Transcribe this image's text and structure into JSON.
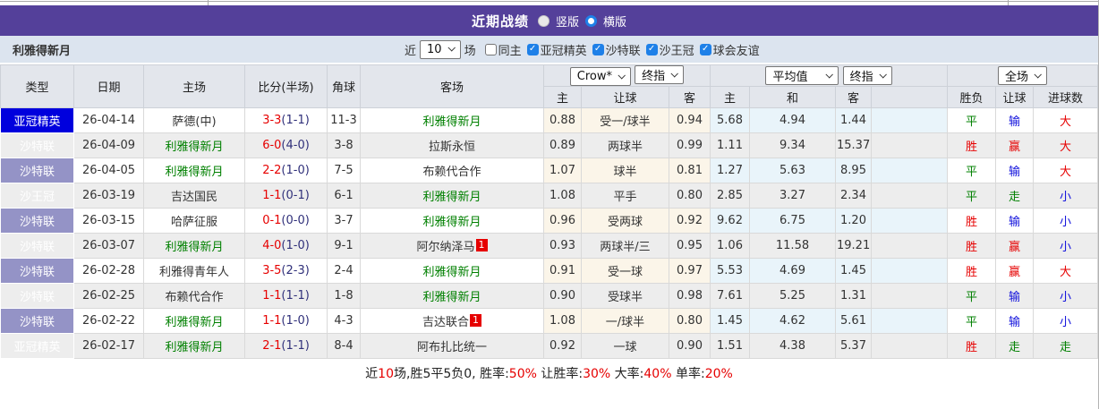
{
  "colors": {
    "accent_purple": "#54409a",
    "filter_bar_bg": "#dce4ef",
    "header_bg": "#e3e6ec",
    "type_acl_blue": "#0000dd",
    "type_saudi_league_purple": "#9493c6",
    "type_kings_cup_navy": "#3f3d8a",
    "team_green": "#008000",
    "win_red": "#e60000",
    "lose_blue": "#1010dc",
    "asian_odds_bg": "#fbf5e9",
    "euro_odds_bg": "#e9f4fa",
    "checkbox_blue": "#1e80e8"
  },
  "title_bar": {
    "title": "近期战绩",
    "vertical_label": "竖版",
    "horizontal_label": "横版",
    "selected_layout": "横版"
  },
  "filter_bar": {
    "team_name": "利雅得新月",
    "near_label": "近",
    "match_count": "10",
    "games_label": "场",
    "checkboxes": [
      {
        "label": "同主",
        "checked": false
      },
      {
        "label": "亚冠精英",
        "checked": true
      },
      {
        "label": "沙特联",
        "checked": true
      },
      {
        "label": "沙王冠",
        "checked": true
      },
      {
        "label": "球会友谊",
        "checked": true
      }
    ]
  },
  "table": {
    "selects": {
      "bookmaker": "Crow*",
      "asian_stage": "终指",
      "euro_source": "平均值",
      "euro_stage": "终指",
      "scope": "全场"
    },
    "headers": {
      "type": "类型",
      "date": "日期",
      "home": "主场",
      "score": "比分(半场)",
      "corner": "角球",
      "away": "客场",
      "asian_home": "主",
      "asian_line": "让球",
      "asian_away": "客",
      "euro_home": "主",
      "euro_draw": "和",
      "euro_away": "客",
      "res_outcome": "胜负",
      "res_handicap": "让球",
      "res_goals": "进球数"
    },
    "rows": [
      {
        "type": "亚冠精英",
        "type_style": "acl",
        "date": "26-04-14",
        "home": "萨德(中)",
        "home_is_team": false,
        "score": "3-3",
        "half": "(1-1)",
        "corner": "11-3",
        "away": "利雅得新月",
        "away_is_team": true,
        "away_badge": "",
        "asian": [
          "0.88",
          "受一/球半",
          "0.94"
        ],
        "euro": [
          "5.68",
          "4.94",
          "1.44"
        ],
        "results": [
          {
            "text": "平",
            "color": "green"
          },
          {
            "text": "输",
            "color": "blue"
          },
          {
            "text": "大",
            "color": "red"
          }
        ]
      },
      {
        "type": "沙特联",
        "type_style": "spl",
        "date": "26-04-09",
        "home": "利雅得新月",
        "home_is_team": true,
        "score": "6-0",
        "half": "(4-0)",
        "corner": "3-8",
        "away": "拉斯永恒",
        "away_is_team": false,
        "away_badge": "",
        "asian": [
          "0.89",
          "两球半",
          "0.99"
        ],
        "euro": [
          "1.11",
          "9.34",
          "15.37"
        ],
        "results": [
          {
            "text": "胜",
            "color": "red"
          },
          {
            "text": "赢",
            "color": "red"
          },
          {
            "text": "大",
            "color": "red"
          }
        ]
      },
      {
        "type": "沙特联",
        "type_style": "spl",
        "date": "26-04-05",
        "home": "利雅得新月",
        "home_is_team": true,
        "score": "2-2",
        "half": "(1-0)",
        "corner": "7-5",
        "away": "布赖代合作",
        "away_is_team": false,
        "away_badge": "",
        "asian": [
          "1.07",
          "球半",
          "0.81"
        ],
        "euro": [
          "1.27",
          "5.63",
          "8.95"
        ],
        "results": [
          {
            "text": "平",
            "color": "green"
          },
          {
            "text": "输",
            "color": "blue"
          },
          {
            "text": "大",
            "color": "red"
          }
        ]
      },
      {
        "type": "沙王冠",
        "type_style": "kingscup",
        "date": "26-03-19",
        "home": "吉达国民",
        "home_is_team": false,
        "score": "1-1",
        "half": "(0-1)",
        "corner": "6-1",
        "away": "利雅得新月",
        "away_is_team": true,
        "away_badge": "",
        "asian": [
          "1.08",
          "平手",
          "0.80"
        ],
        "euro": [
          "2.85",
          "3.27",
          "2.34"
        ],
        "results": [
          {
            "text": "平",
            "color": "green"
          },
          {
            "text": "走",
            "color": "green"
          },
          {
            "text": "小",
            "color": "blue"
          }
        ]
      },
      {
        "type": "沙特联",
        "type_style": "spl",
        "date": "26-03-15",
        "home": "哈萨征服",
        "home_is_team": false,
        "score": "0-1",
        "half": "(0-0)",
        "corner": "3-7",
        "away": "利雅得新月",
        "away_is_team": true,
        "away_badge": "",
        "asian": [
          "0.96",
          "受两球",
          "0.92"
        ],
        "euro": [
          "9.62",
          "6.75",
          "1.20"
        ],
        "results": [
          {
            "text": "胜",
            "color": "red"
          },
          {
            "text": "输",
            "color": "blue"
          },
          {
            "text": "小",
            "color": "blue"
          }
        ]
      },
      {
        "type": "沙特联",
        "type_style": "spl",
        "date": "26-03-07",
        "home": "利雅得新月",
        "home_is_team": true,
        "score": "4-0",
        "half": "(1-0)",
        "corner": "9-1",
        "away": "阿尔纳泽马",
        "away_is_team": false,
        "away_badge": "1",
        "asian": [
          "0.93",
          "两球半/三",
          "0.95"
        ],
        "euro": [
          "1.06",
          "11.58",
          "19.21"
        ],
        "results": [
          {
            "text": "胜",
            "color": "red"
          },
          {
            "text": "赢",
            "color": "red"
          },
          {
            "text": "小",
            "color": "blue"
          }
        ]
      },
      {
        "type": "沙特联",
        "type_style": "spl",
        "date": "26-02-28",
        "home": "利雅得青年人",
        "home_is_team": false,
        "score": "3-5",
        "half": "(2-3)",
        "corner": "2-4",
        "away": "利雅得新月",
        "away_is_team": true,
        "away_badge": "",
        "asian": [
          "0.91",
          "受一球",
          "0.97"
        ],
        "euro": [
          "5.53",
          "4.69",
          "1.45"
        ],
        "results": [
          {
            "text": "胜",
            "color": "red"
          },
          {
            "text": "赢",
            "color": "red"
          },
          {
            "text": "大",
            "color": "red"
          }
        ]
      },
      {
        "type": "沙特联",
        "type_style": "spl",
        "date": "26-02-25",
        "home": "布赖代合作",
        "home_is_team": false,
        "score": "1-1",
        "half": "(1-1)",
        "corner": "1-8",
        "away": "利雅得新月",
        "away_is_team": true,
        "away_badge": "",
        "asian": [
          "0.90",
          "受球半",
          "0.98"
        ],
        "euro": [
          "7.61",
          "5.25",
          "1.31"
        ],
        "results": [
          {
            "text": "平",
            "color": "green"
          },
          {
            "text": "输",
            "color": "blue"
          },
          {
            "text": "小",
            "color": "blue"
          }
        ]
      },
      {
        "type": "沙特联",
        "type_style": "spl",
        "date": "26-02-22",
        "home": "利雅得新月",
        "home_is_team": true,
        "score": "1-1",
        "half": "(1-0)",
        "corner": "4-3",
        "away": "吉达联合",
        "away_is_team": false,
        "away_badge": "1",
        "asian": [
          "1.08",
          "一/球半",
          "0.80"
        ],
        "euro": [
          "1.45",
          "4.62",
          "5.61"
        ],
        "results": [
          {
            "text": "平",
            "color": "green"
          },
          {
            "text": "输",
            "color": "blue"
          },
          {
            "text": "小",
            "color": "blue"
          }
        ]
      },
      {
        "type": "亚冠精英",
        "type_style": "acl",
        "date": "26-02-17",
        "home": "利雅得新月",
        "home_is_team": true,
        "score": "2-1",
        "half": "(1-1)",
        "corner": "8-4",
        "away": "阿布扎比统一",
        "away_is_team": false,
        "away_badge": "",
        "asian": [
          "0.92",
          "一球",
          "0.90"
        ],
        "euro": [
          "1.51",
          "4.38",
          "5.37"
        ],
        "results": [
          {
            "text": "胜",
            "color": "red"
          },
          {
            "text": "走",
            "color": "green"
          },
          {
            "text": "走",
            "color": "green"
          }
        ]
      }
    ]
  },
  "summary": {
    "segments": [
      {
        "text": "近",
        "red": false
      },
      {
        "text": "10",
        "red": true
      },
      {
        "text": "场,胜5平5负0, 胜率:",
        "red": false
      },
      {
        "text": "50%",
        "red": true
      },
      {
        "text": " 让胜率:",
        "red": false
      },
      {
        "text": "30%",
        "red": true
      },
      {
        "text": " 大率:",
        "red": false
      },
      {
        "text": "40%",
        "red": true
      },
      {
        "text": " 单率:",
        "red": false
      },
      {
        "text": "20%",
        "red": true
      }
    ]
  }
}
